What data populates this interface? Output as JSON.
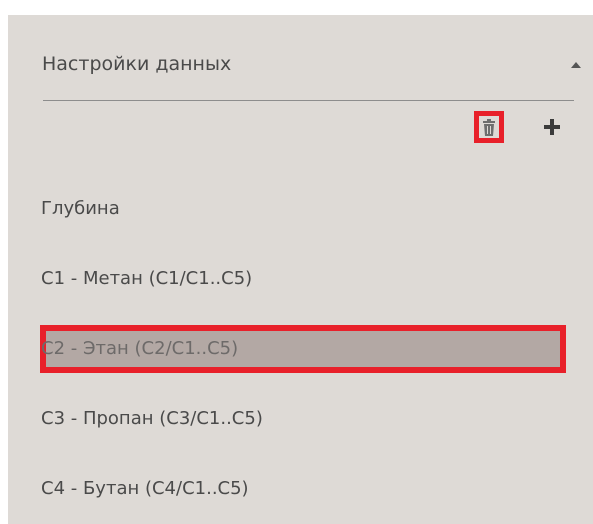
{
  "panel": {
    "title": "Настройки данных"
  },
  "toolbar": {
    "delete_icon": "trash-icon",
    "add_icon": "plus-icon"
  },
  "list": {
    "items": [
      {
        "label": "Глубина",
        "selected": false
      },
      {
        "label": "C1 - Метан (C1/C1..C5)",
        "selected": false
      },
      {
        "label": "C2 - Этан (C2/C1..C5)",
        "selected": true
      },
      {
        "label": "C3 - Пропан (C3/C1..C5)",
        "selected": false
      },
      {
        "label": "C4 - Бутан (C4/C1..C5)",
        "selected": false
      }
    ]
  },
  "colors": {
    "panel_bg": "#dedad6",
    "selected_bg": "#b3a8a4",
    "highlight_border": "#e8202a",
    "text": "#4a4a4a"
  }
}
